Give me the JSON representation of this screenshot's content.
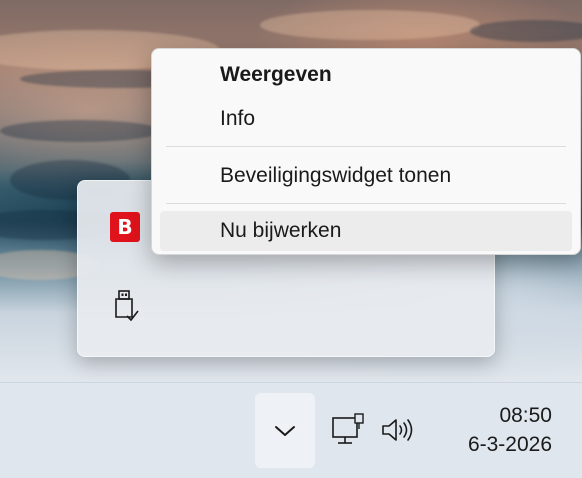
{
  "context_menu": {
    "items": [
      {
        "label": "Weergeven",
        "bold": true
      },
      {
        "label": "Info"
      },
      {
        "label": "Beveiligingswidget tonen"
      },
      {
        "label": "Nu bijwerken",
        "hovered": true
      }
    ]
  },
  "tray_flyout": {
    "icons": [
      "security-app-icon",
      "usb-safely-remove-icon"
    ],
    "security_logo_letter": "B",
    "brand_color": "#e0121b"
  },
  "taskbar": {
    "icons": [
      "chevron-up-icon",
      "network-icon",
      "volume-icon"
    ],
    "clock": {
      "time": "08:50",
      "date": "6-3-2026"
    }
  }
}
